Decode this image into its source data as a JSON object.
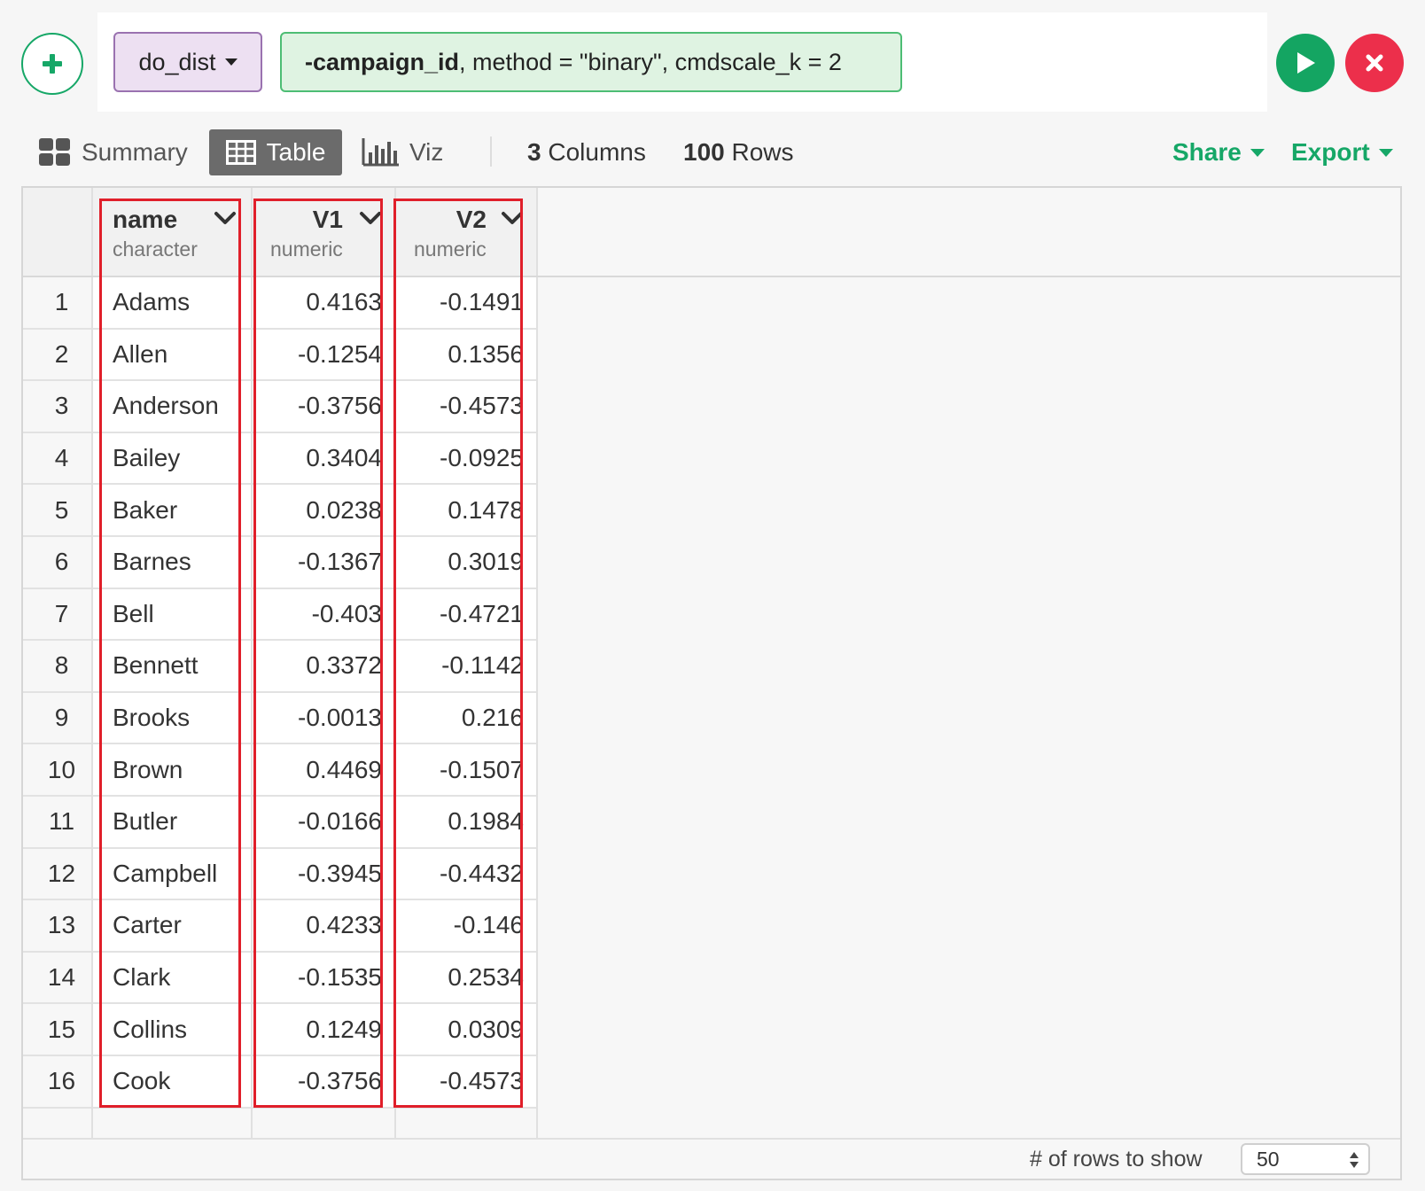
{
  "command": {
    "function": "do_dist",
    "args_bold": "-campaign_id",
    "args_rest": ", method = \"binary\", cmdscale_k = 2"
  },
  "toolbar": {
    "summary": "Summary",
    "table": "Table",
    "viz": "Viz",
    "columns_count": "3",
    "columns_label": "Columns",
    "rows_count": "100",
    "rows_label": "Rows",
    "share": "Share",
    "export": "Export"
  },
  "table": {
    "columns": [
      {
        "name": "name",
        "type": "character"
      },
      {
        "name": "V1",
        "type": "numeric"
      },
      {
        "name": "V2",
        "type": "numeric"
      }
    ],
    "rows": [
      {
        "i": "1",
        "name": "Adams",
        "v1": "0.4163",
        "v2": "-0.1491"
      },
      {
        "i": "2",
        "name": "Allen",
        "v1": "-0.1254",
        "v2": "0.1356"
      },
      {
        "i": "3",
        "name": "Anderson",
        "v1": "-0.3756",
        "v2": "-0.4573"
      },
      {
        "i": "4",
        "name": "Bailey",
        "v1": "0.3404",
        "v2": "-0.0925"
      },
      {
        "i": "5",
        "name": "Baker",
        "v1": "0.0238",
        "v2": "0.1478"
      },
      {
        "i": "6",
        "name": "Barnes",
        "v1": "-0.1367",
        "v2": "0.3019"
      },
      {
        "i": "7",
        "name": "Bell",
        "v1": "-0.403",
        "v2": "-0.4721"
      },
      {
        "i": "8",
        "name": "Bennett",
        "v1": "0.3372",
        "v2": "-0.1142"
      },
      {
        "i": "9",
        "name": "Brooks",
        "v1": "-0.0013",
        "v2": "0.216"
      },
      {
        "i": "10",
        "name": "Brown",
        "v1": "0.4469",
        "v2": "-0.1507"
      },
      {
        "i": "11",
        "name": "Butler",
        "v1": "-0.0166",
        "v2": "0.1984"
      },
      {
        "i": "12",
        "name": "Campbell",
        "v1": "-0.3945",
        "v2": "-0.4432"
      },
      {
        "i": "13",
        "name": "Carter",
        "v1": "0.4233",
        "v2": "-0.146"
      },
      {
        "i": "14",
        "name": "Clark",
        "v1": "-0.1535",
        "v2": "0.2534"
      },
      {
        "i": "15",
        "name": "Collins",
        "v1": "0.1249",
        "v2": "0.0309"
      },
      {
        "i": "16",
        "name": "Cook",
        "v1": "-0.3756",
        "v2": "-0.4573"
      }
    ]
  },
  "footer": {
    "rows_to_show_label": "# of rows to show",
    "rows_to_show_value": "50"
  },
  "colors": {
    "accent_green": "#16a767",
    "run_green": "#14a562",
    "cancel_red": "#ec2f4b",
    "highlight_red": "#e01f2a",
    "function_bg": "#ede0f2",
    "args_bg": "#dff3e2"
  },
  "icons": [
    "plus-icon",
    "caret-down-icon",
    "play-icon",
    "close-icon",
    "grid-icon",
    "table-icon",
    "bar-chart-icon",
    "chevron-down-icon",
    "updown-arrows-icon"
  ]
}
